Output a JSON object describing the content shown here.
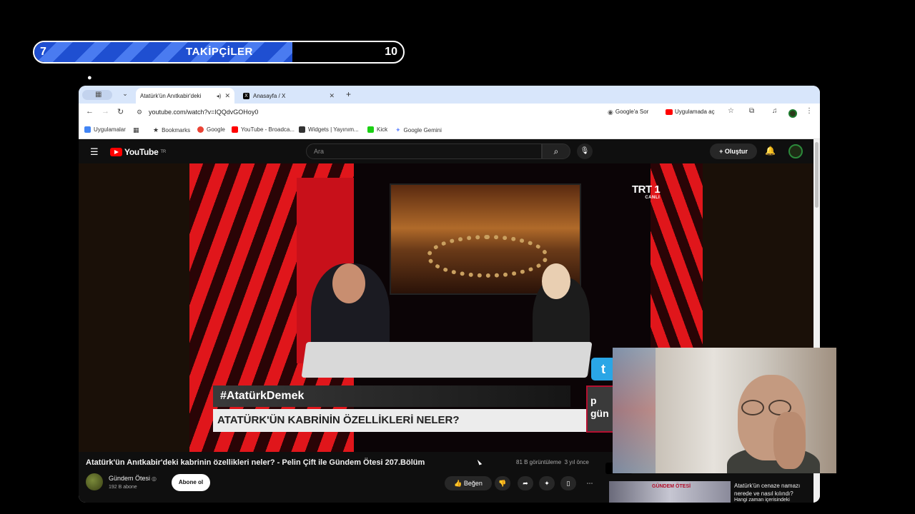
{
  "overlay": {
    "follower_title": "TAKİPÇİLER",
    "follower_current": "7",
    "follower_goal": "10",
    "follower_progress": 0.7
  },
  "browser": {
    "tabs": [
      {
        "title": "Atatürk'ün Anıtkabir'deki",
        "active": true
      },
      {
        "title": "Anasayfa / X",
        "active": false
      }
    ],
    "url": "youtube.com/watch?v=IQQdvGOHoy0",
    "toolbar": {
      "google_lens_label": "Google'a Sor",
      "open_in_app_label": "Uygulamada aç"
    },
    "bookmarks": [
      {
        "label": "Uygulamalar",
        "icon": "apps-grid-icon",
        "color": "#4285f4"
      },
      {
        "label": "Bookmarks",
        "icon": "star-icon",
        "color": "#555555"
      },
      {
        "label": "Google",
        "icon": "google-icon",
        "color": "#ea4335"
      },
      {
        "label": "YouTube - Broadca...",
        "icon": "youtube-icon",
        "color": "#ff0000"
      },
      {
        "label": "Widgets | Yayınım...",
        "icon": "widgets-icon",
        "color": "#333333"
      },
      {
        "label": "Kick",
        "icon": "kick-icon",
        "color": "#1bd014"
      },
      {
        "label": "Google Gemini",
        "icon": "gemini-icon",
        "color": "#6b8cff"
      }
    ]
  },
  "youtube": {
    "logo_text": "YouTube",
    "logo_region": "TR",
    "search_placeholder": "Ara",
    "create_label": "Oluştur",
    "video": {
      "hashtag": "#AtatürkDemek",
      "lower_third": "ATATÜRK'ÜN KABRİNİN ÖZELLİKLERİ NELER?",
      "channel_bug": "TRT 1",
      "channel_bug_sub": "CANLI",
      "corner_logo": "p gün",
      "twitter_glyph": "t"
    },
    "title": "Atatürk'ün Anıtkabir'deki kabrinin özellikleri neler? - Pelin Çift ile Gündem Ötesi 207.Bölüm",
    "views": "81 B görüntüleme",
    "age": "3 yıl önce",
    "channel": {
      "name": "Gündem Ötesi",
      "subscribers": "192 B abone",
      "subscribe_label": "Abone ol"
    },
    "actions": {
      "like_label": "Beğen"
    },
    "sidebar": {
      "thumbnail_text": "GÜNDEM ÖTESİ",
      "title": "Atatürk'ün cenaze namazı nerede ve nasıl kılındı?",
      "subtitle": "Hangi zaman içerisindeki"
    }
  }
}
